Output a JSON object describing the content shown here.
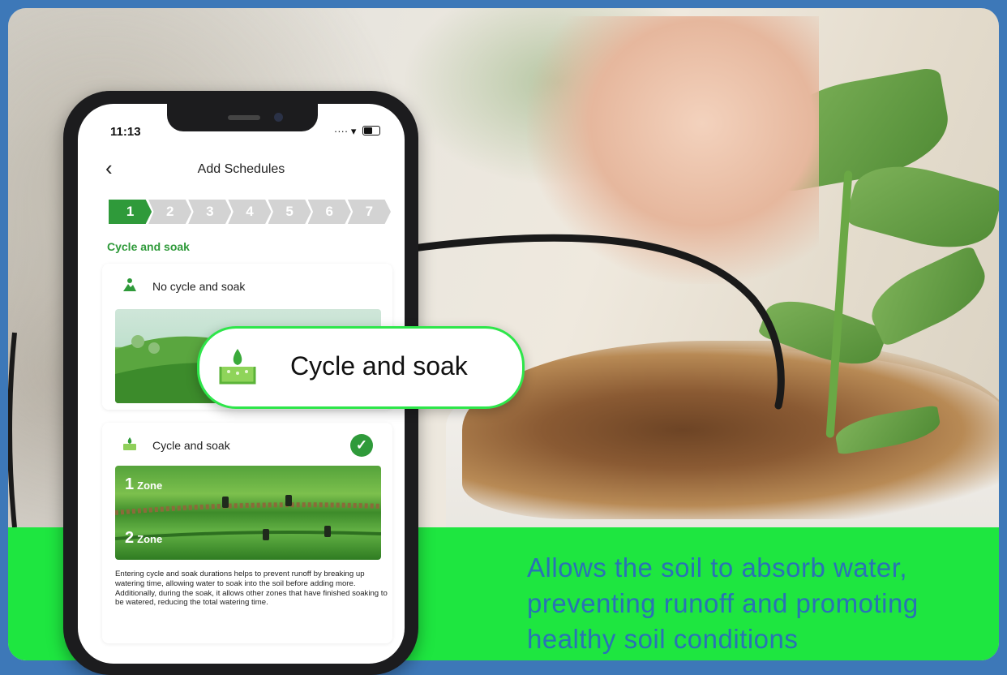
{
  "phone": {
    "time": "11:13",
    "header_title": "Add Schedules",
    "steps": [
      "1",
      "2",
      "3",
      "4",
      "5",
      "6",
      "7"
    ],
    "section_label": "Cycle and soak",
    "option_none_title": "No cycle and soak",
    "option_cycle_title": "Cycle and soak",
    "zone1_number": "1",
    "zone1_label": "Zone",
    "zone2_number": "2",
    "zone2_label": "Zone",
    "description": "Entering cycle and soak durations helps to prevent runoff by breaking up watering time, allowing water to soak into the soil before adding more. Additionally, during the soak, it allows other zones that have finished soaking to be watered, reducing the total watering time."
  },
  "callout": {
    "label": "Cycle and soak"
  },
  "caption": {
    "line1": "Allows the soil to absorb water,",
    "line2": "preventing runoff and promoting",
    "line3": "healthy soil conditions"
  },
  "colors": {
    "accent_green": "#2f9a3a",
    "band_green": "#1ee640",
    "caption_blue": "#2a72b5",
    "frame_blue": "#3d78b8"
  }
}
